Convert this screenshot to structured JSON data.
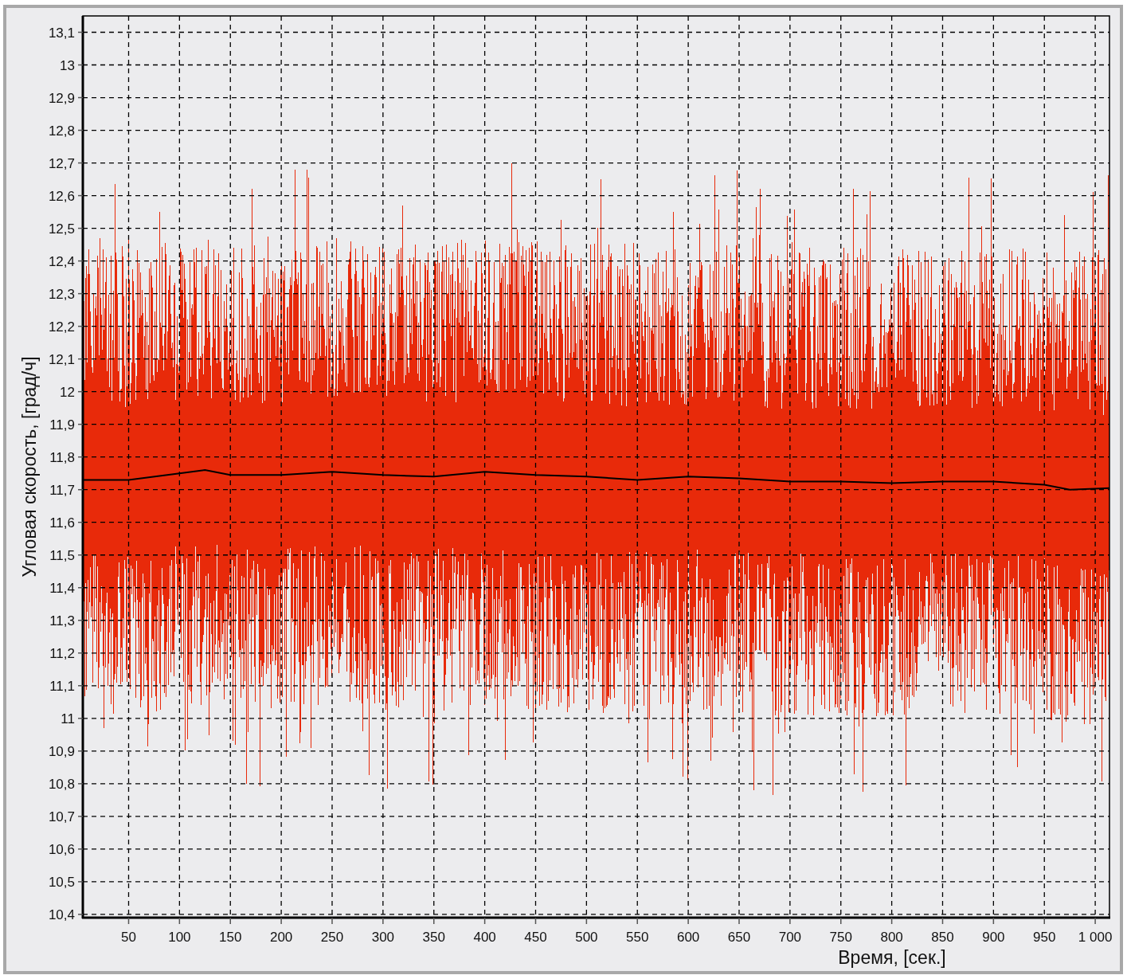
{
  "chart_data": {
    "type": "line",
    "grid": true,
    "xlabel": "Время, [сек.]",
    "ylabel": "Угловая скорость, [град/ч]",
    "xlim": [
      5,
      1014
    ],
    "ylim": [
      10.39,
      13.15
    ],
    "xticks": [
      50,
      100,
      150,
      200,
      250,
      300,
      350,
      400,
      450,
      500,
      550,
      600,
      650,
      700,
      750,
      800,
      850,
      900,
      950,
      {
        "value": 1000,
        "label": "1 000"
      }
    ],
    "yticks": [
      {
        "value": 10.4,
        "label": "10,4"
      },
      {
        "value": 10.5,
        "label": "10,5"
      },
      {
        "value": 10.6,
        "label": "10,6"
      },
      {
        "value": 10.7,
        "label": "10,7"
      },
      {
        "value": 10.8,
        "label": "10,8"
      },
      {
        "value": 10.9,
        "label": "10,9"
      },
      {
        "value": 11,
        "label": "11"
      },
      {
        "value": 11.1,
        "label": "11,1"
      },
      {
        "value": 11.2,
        "label": "11,2"
      },
      {
        "value": 11.3,
        "label": "11,3"
      },
      {
        "value": 11.4,
        "label": "11,4"
      },
      {
        "value": 11.5,
        "label": "11,5"
      },
      {
        "value": 11.6,
        "label": "11,6"
      },
      {
        "value": 11.7,
        "label": "11,7"
      },
      {
        "value": 11.8,
        "label": "11,8"
      },
      {
        "value": 11.9,
        "label": "11,9"
      },
      {
        "value": 12,
        "label": "12"
      },
      {
        "value": 12.1,
        "label": "12,1"
      },
      {
        "value": 12.2,
        "label": "12,2"
      },
      {
        "value": 12.3,
        "label": "12,3"
      },
      {
        "value": 12.4,
        "label": "12,4"
      },
      {
        "value": 12.5,
        "label": "12,5"
      },
      {
        "value": 12.6,
        "label": "12,6"
      },
      {
        "value": 12.7,
        "label": "12,7"
      },
      {
        "value": 12.8,
        "label": "12,8"
      },
      {
        "value": 12.9,
        "label": "12,9"
      },
      {
        "value": 13,
        "label": "13"
      },
      {
        "value": 13.1,
        "label": "13,1"
      }
    ],
    "x": [
      5,
      50,
      100,
      125,
      150,
      200,
      250,
      300,
      350,
      400,
      450,
      500,
      550,
      600,
      650,
      700,
      750,
      800,
      850,
      900,
      950,
      975,
      1014
    ],
    "series": [
      {
        "color": "#000000",
        "values": [
          11.73,
          11.73,
          11.75,
          11.76,
          11.745,
          11.745,
          11.755,
          11.745,
          11.74,
          11.755,
          11.745,
          11.74,
          11.73,
          11.74,
          11.735,
          11.725,
          11.725,
          11.72,
          11.725,
          11.725,
          11.715,
          11.7,
          11.705
        ]
      }
    ]
  }
}
